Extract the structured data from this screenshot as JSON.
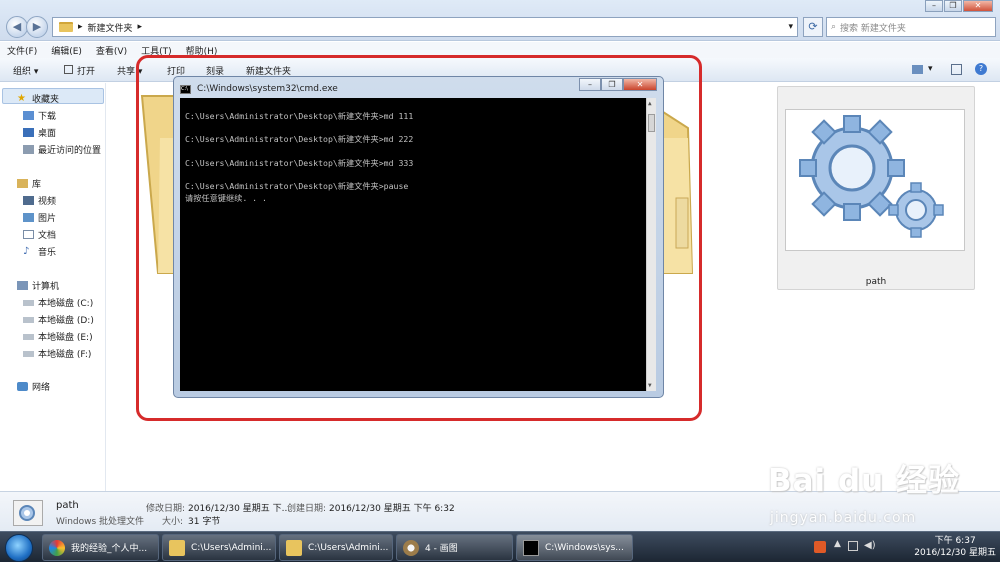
{
  "explorer": {
    "breadcrumb": [
      "新建文件夹"
    ],
    "search_placeholder": "搜索 新建文件夹",
    "menu": [
      "文件(F)",
      "编辑(E)",
      "查看(V)",
      "工具(T)",
      "帮助(H)"
    ],
    "toolbar": {
      "organize": "组织 ▾",
      "open": "打开",
      "share": "共享 ▾",
      "print": "打印",
      "burn": "刻录",
      "new_folder": "新建文件夹"
    },
    "sidebar": {
      "favorites": "收藏夹",
      "downloads": "下载",
      "desktop": "桌面",
      "recent": "最近访问的位置",
      "libraries": "库",
      "videos": "视频",
      "pictures": "图片",
      "documents": "文档",
      "music": "音乐",
      "computer": "计算机",
      "disk_c": "本地磁盘 (C:)",
      "disk_d": "本地磁盘 (D:)",
      "disk_e": "本地磁盘 (E:)",
      "disk_f": "本地磁盘 (F:)",
      "network": "网络"
    },
    "file_thumb_label": "path",
    "details": {
      "name": "path",
      "type": "Windows 批处理文件",
      "modified_label": "修改日期:",
      "modified": "2016/12/30 星期五 下...",
      "created_label": "创建日期:",
      "created": "2016/12/30 星期五 下午 6:32",
      "size_label": "大小:",
      "size": "31 字节"
    }
  },
  "cmd": {
    "title": "C:\\Windows\\system32\\cmd.exe",
    "lines": [
      "C:\\Users\\Administrator\\Desktop\\新建文件夹>md 111",
      "",
      "C:\\Users\\Administrator\\Desktop\\新建文件夹>md 222",
      "",
      "C:\\Users\\Administrator\\Desktop\\新建文件夹>md 333",
      "",
      "C:\\Users\\Administrator\\Desktop\\新建文件夹>pause",
      "请按任意键继续. . ."
    ]
  },
  "taskbar": {
    "tasks": [
      {
        "label": "我的经验_个人中...",
        "icon": "browser-icon"
      },
      {
        "label": "C:\\Users\\Admini...",
        "icon": "folder-icon"
      },
      {
        "label": "C:\\Users\\Admini...",
        "icon": "folder-icon"
      },
      {
        "label": "4 - 画图",
        "icon": "paint-icon"
      },
      {
        "label": "C:\\Windows\\sys...",
        "icon": "cmd-icon"
      }
    ],
    "time": "下午 6:37",
    "date": "2016/12/30 星期五"
  },
  "watermark": {
    "brand": "Bai du 经验",
    "url": "jingyan.baidu.com"
  },
  "colors": {
    "highlight": "#d62b2b",
    "console_bg": "#000000",
    "console_fg": "#c0c0c0"
  }
}
